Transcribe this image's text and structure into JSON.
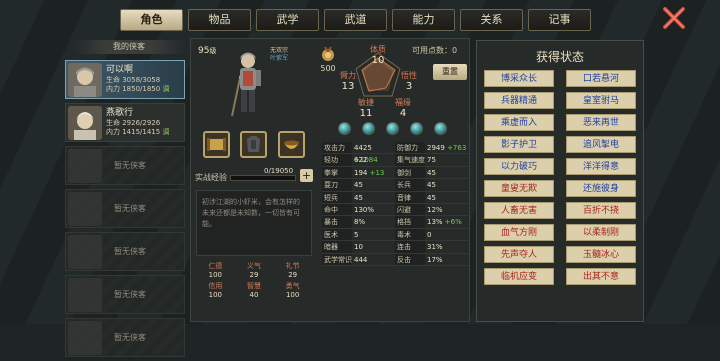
{
  "tabs": [
    "角色",
    "物品",
    "武学",
    "武道",
    "能力",
    "关系",
    "记事"
  ],
  "roster": {
    "title": "我的侠客",
    "heroes": [
      {
        "name": "可以啊",
        "hp": "生命 3058/3058",
        "mp": "内力 1850/1850",
        "tag": "调"
      },
      {
        "name": "燕歌行",
        "hp": "生命 2926/2926",
        "mp": "内力 1415/1415",
        "tag": "调"
      }
    ],
    "empty_label": "暂无侠客"
  },
  "character": {
    "level": "95",
    "level_unit": "级",
    "title_line1": "无双宗",
    "title_line2": "叶紫军",
    "medal_value": "500"
  },
  "attributes": {
    "constitution": {
      "label": "体质",
      "value": "10"
    },
    "strength": {
      "label": "臂力",
      "value": "13"
    },
    "insight": {
      "label": "悟性",
      "value": "3"
    },
    "agility": {
      "label": "敏捷",
      "value": "11"
    },
    "luck": {
      "label": "福缘",
      "value": "4"
    }
  },
  "free_points": "可用点数：0",
  "reset_label": "重置",
  "exp": {
    "label": "实战经验",
    "value": "0/19050",
    "fill": 0.0
  },
  "bio": "初涉江湖的小虾米，会有怎样的未来还都是未知数，一切皆有可能。",
  "virtues": [
    {
      "label": "仁德",
      "value": "100"
    },
    {
      "label": "义气",
      "value": "29"
    },
    {
      "label": "礼节",
      "value": "29"
    },
    {
      "label": "信用",
      "value": "100"
    },
    {
      "label": "智慧",
      "value": "40"
    },
    {
      "label": "勇气",
      "value": "100"
    }
  ],
  "stats": [
    [
      {
        "k": "攻击力",
        "v": "4425",
        "p": "+1084"
      },
      {
        "k": "防御力",
        "v": "2949",
        "p": "+763"
      }
    ],
    [
      {
        "k": "轻功",
        "v": "622",
        "p": ""
      },
      {
        "k": "集气速度",
        "v": "75",
        "p": ""
      }
    ],
    [
      {
        "k": "拳掌",
        "v": "194",
        "p": "+13"
      },
      {
        "k": "御剑",
        "v": "45",
        "p": ""
      }
    ],
    [
      {
        "k": "耍刀",
        "v": "45",
        "p": ""
      },
      {
        "k": "长兵",
        "v": "45",
        "p": ""
      }
    ],
    [
      {
        "k": "短兵",
        "v": "45",
        "p": ""
      },
      {
        "k": "音律",
        "v": "45",
        "p": ""
      }
    ],
    [
      {
        "k": "命中",
        "v": "130%",
        "p": ""
      },
      {
        "k": "闪避",
        "v": "12%",
        "p": ""
      }
    ],
    [
      {
        "k": "暴击",
        "v": "8%",
        "p": ""
      },
      {
        "k": "格挡",
        "v": "13%",
        "p": "+6%"
      }
    ],
    [
      {
        "k": "医术",
        "v": "5",
        "p": ""
      },
      {
        "k": "毒术",
        "v": "0",
        "p": ""
      }
    ],
    [
      {
        "k": "暗器",
        "v": "10",
        "p": ""
      },
      {
        "k": "连击",
        "v": "31%",
        "p": ""
      }
    ],
    [
      {
        "k": "武学常识",
        "v": "444",
        "p": ""
      },
      {
        "k": "反击",
        "v": "17%",
        "p": ""
      }
    ]
  ],
  "status": {
    "title": "获得状态",
    "items": [
      {
        "label": "博采众长",
        "color": "blue"
      },
      {
        "label": "口若悬河",
        "color": "blue"
      },
      {
        "label": "兵器精通",
        "color": "blue"
      },
      {
        "label": "皇室驸马",
        "color": "blue"
      },
      {
        "label": "乘虚而入",
        "color": "blue"
      },
      {
        "label": "恶来再世",
        "color": "blue"
      },
      {
        "label": "影子护卫",
        "color": "blue"
      },
      {
        "label": "追风掣电",
        "color": "blue"
      },
      {
        "label": "以力破巧",
        "color": "blue"
      },
      {
        "label": "洋洋得意",
        "color": "blue"
      },
      {
        "label": "童叟无欺",
        "color": "red"
      },
      {
        "label": "还施彼身",
        "color": "blue"
      },
      {
        "label": "人畜无害",
        "color": "red"
      },
      {
        "label": "百折不挠",
        "color": "red"
      },
      {
        "label": "血气方刚",
        "color": "red"
      },
      {
        "label": "以柔制刚",
        "color": "red"
      },
      {
        "label": "先声夺人",
        "color": "red"
      },
      {
        "label": "玉髓冰心",
        "color": "red"
      },
      {
        "label": "临机应变",
        "color": "red"
      },
      {
        "label": "出其不意",
        "color": "red"
      }
    ]
  }
}
